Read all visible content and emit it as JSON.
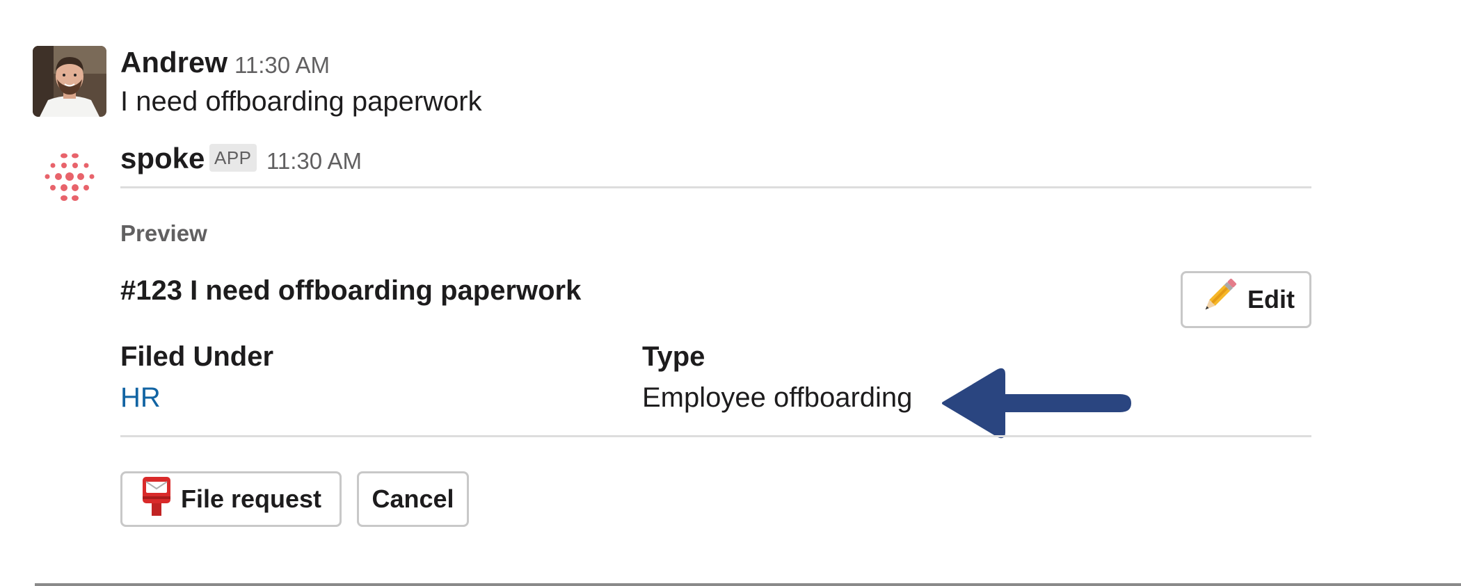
{
  "messages": [
    {
      "sender": "Andrew",
      "time": "11:30 AM",
      "text": "I need offboarding paperwork",
      "avatar_icon": "user-photo"
    },
    {
      "sender": "spoke",
      "badge": "APP",
      "time": "11:30 AM",
      "logo_icon": "spoke-dots-logo"
    }
  ],
  "preview": {
    "label": "Preview",
    "request_title": "#123 I need offboarding paperwork",
    "edit_button": {
      "label": "Edit",
      "icon": "pencil-icon"
    },
    "fields": [
      {
        "label": "Filed Under",
        "value": "HR",
        "is_link": true
      },
      {
        "label": "Type",
        "value": "Employee offboarding",
        "is_link": false
      }
    ]
  },
  "actions": {
    "file_request": {
      "label": "File request",
      "icon": "postbox-icon"
    },
    "cancel": {
      "label": "Cancel"
    }
  },
  "annotation": {
    "arrow_icon": "arrow-left-icon",
    "arrow_color": "#2a4580"
  },
  "colors": {
    "link": "#1264a3",
    "logo": "#e8636b",
    "muted_text": "#616061"
  }
}
